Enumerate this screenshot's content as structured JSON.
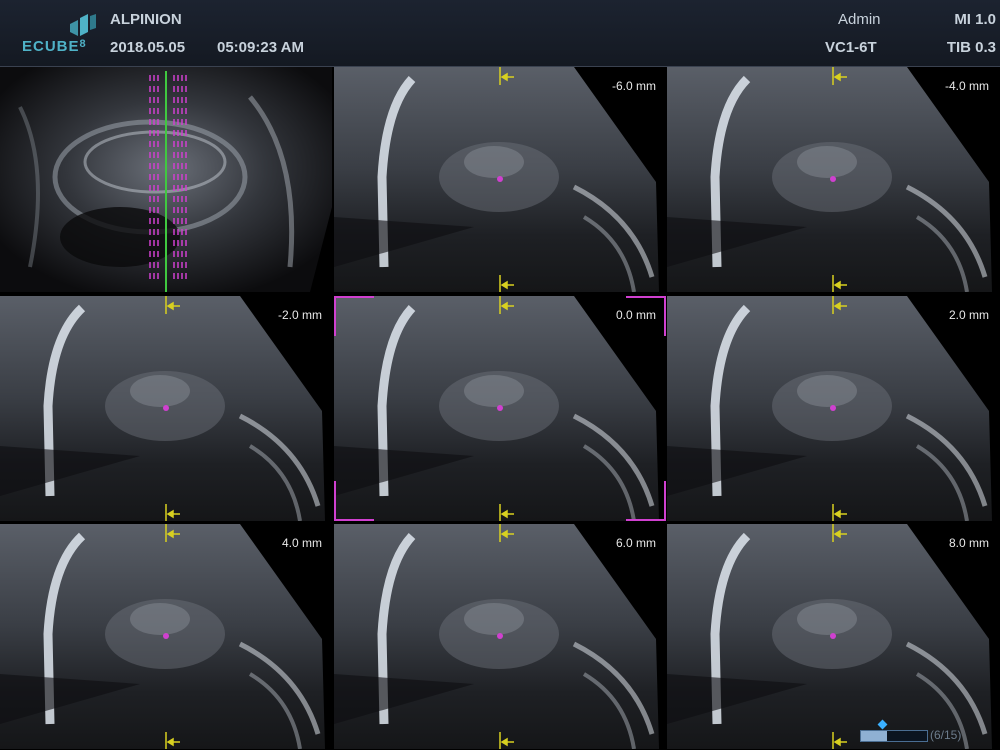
{
  "header": {
    "logo_text": "ECUBE",
    "logo_version": "8",
    "brand": "ALPINION",
    "date": "2018.05.05",
    "time": "05:09:23  AM",
    "user": "Admin",
    "probe": "VC1-6T",
    "mi": "MI 1.0",
    "tib": "TIB 0.3"
  },
  "colors": {
    "accent_teal": "#4fb2c7",
    "marker_magenta": "#d040d0",
    "guide_green": "#40c840",
    "guide_yellow": "#d8d020"
  },
  "slices": [
    {
      "label": "-6.0 mm"
    },
    {
      "label": "-4.0 mm"
    },
    {
      "label": "-2.0 mm"
    },
    {
      "label": "0.0 mm",
      "selected": true
    },
    {
      "label": "2.0 mm"
    },
    {
      "label": "4.0 mm"
    },
    {
      "label": "6.0 mm"
    },
    {
      "label": "8.0 mm"
    }
  ],
  "progress": {
    "text": "(6/15)",
    "fraction": 0.4
  }
}
